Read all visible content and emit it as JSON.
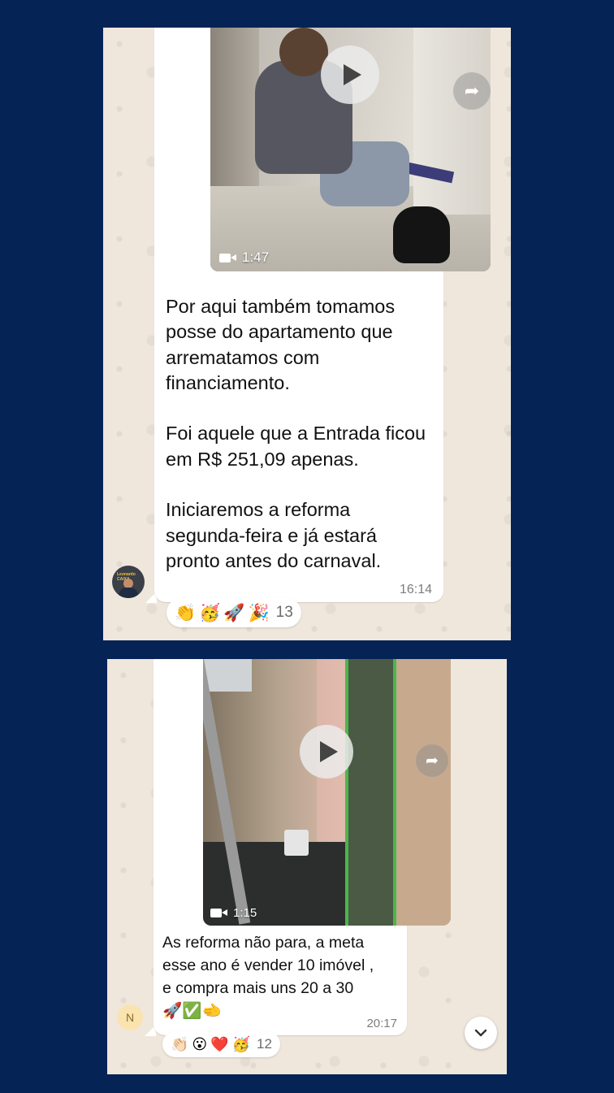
{
  "messages": [
    {
      "video_duration": "1:47",
      "text": "Por aqui também tomamos\nposse do apartamento que\narrematamos com\nfinanciamento.\n\nFoi aquele que a Entrada ficou\nem R$ 251,09 apenas.\n\nIniciaremos a reforma\nsegunda-feira e já estará\npronto antes do carnaval.",
      "time": "16:14",
      "reactions": [
        "👏",
        "🥳",
        "🚀",
        "🎉"
      ],
      "reaction_count": "13",
      "avatar_label": "Leonardo CAIXA"
    },
    {
      "video_duration": "1:15",
      "text": "As reforma não para, a meta\nesse ano é vender 10 imóvel ,\ne compra mais uns 20 a 30\n🚀✅🫲",
      "time": "20:17",
      "reactions": [
        "👏🏻",
        "😮",
        "❤️",
        "🥳"
      ],
      "reaction_count": "12",
      "avatar_initial": "N"
    }
  ],
  "icons": {
    "forward": "forward-icon",
    "play": "play-icon",
    "video": "video-camera-icon",
    "scroll_down": "chevron-down-icon"
  },
  "colors": {
    "page_background": "#062356",
    "chat_background": "#efe7dc",
    "bubble": "#ffffff",
    "timestamp": "#7d7d7d"
  }
}
